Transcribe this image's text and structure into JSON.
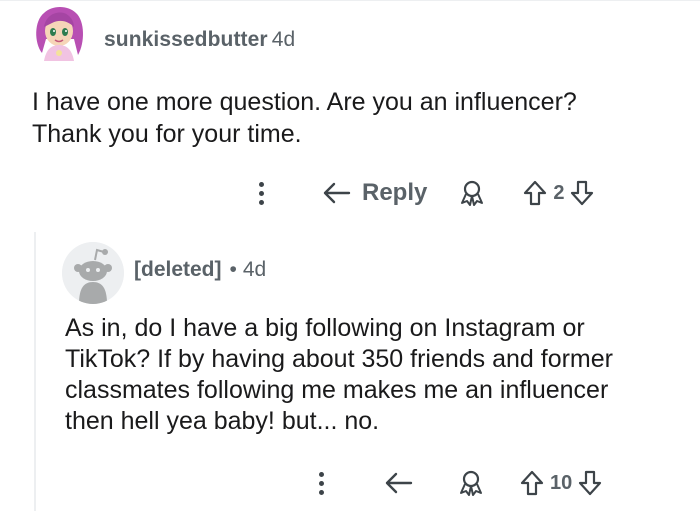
{
  "comment1": {
    "username": "sunkissedbutter",
    "age": "4d",
    "body_line1": "I have one more question. Are you an influencer?",
    "body_line2": "Thank you for your time.",
    "reply_label": "Reply",
    "vote_count": "2",
    "icons": [
      "more-options-icon",
      "reply-arrow-icon",
      "award-icon",
      "upvote-icon",
      "downvote-icon"
    ]
  },
  "comment2": {
    "username": "[deleted]",
    "separator": "•",
    "age": "4d",
    "body_lines": [
      "As in, do I have a big following on Instagram or",
      "TikTok? If by having about 350 friends and former",
      "classmates following me makes me an influencer",
      "then hell yea baby! but... no."
    ],
    "vote_count": "10",
    "icons": [
      "more-options-icon",
      "reply-arrow-icon",
      "award-icon",
      "upvote-icon",
      "downvote-icon"
    ]
  },
  "colors": {
    "meta_text": "#5a6268",
    "body_text": "#1a1a1b",
    "divider": "#edeff1",
    "avatar_pink": "#c858b8"
  }
}
